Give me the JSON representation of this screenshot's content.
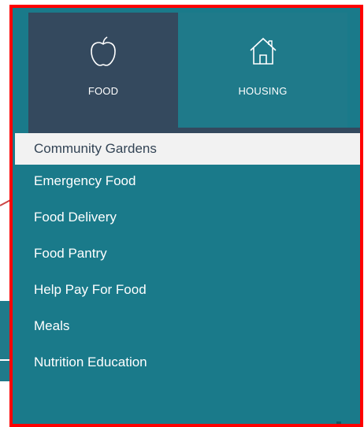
{
  "tabs": [
    {
      "label": "FOOD",
      "icon": "apple-icon",
      "active": true
    },
    {
      "label": "HOUSING",
      "icon": "house-icon",
      "active": false
    }
  ],
  "menu": {
    "items": [
      "Community Gardens",
      "Emergency Food",
      "Food Delivery",
      "Food Pantry",
      "Help Pay For Food",
      "Meals",
      "Nutrition Education"
    ],
    "selected_index": 0
  },
  "colors": {
    "panel": "#1a7a8a",
    "active_tab": "#34495e",
    "selected_item_bg": "#f2f2f2",
    "frame_border": "#ff0000"
  }
}
